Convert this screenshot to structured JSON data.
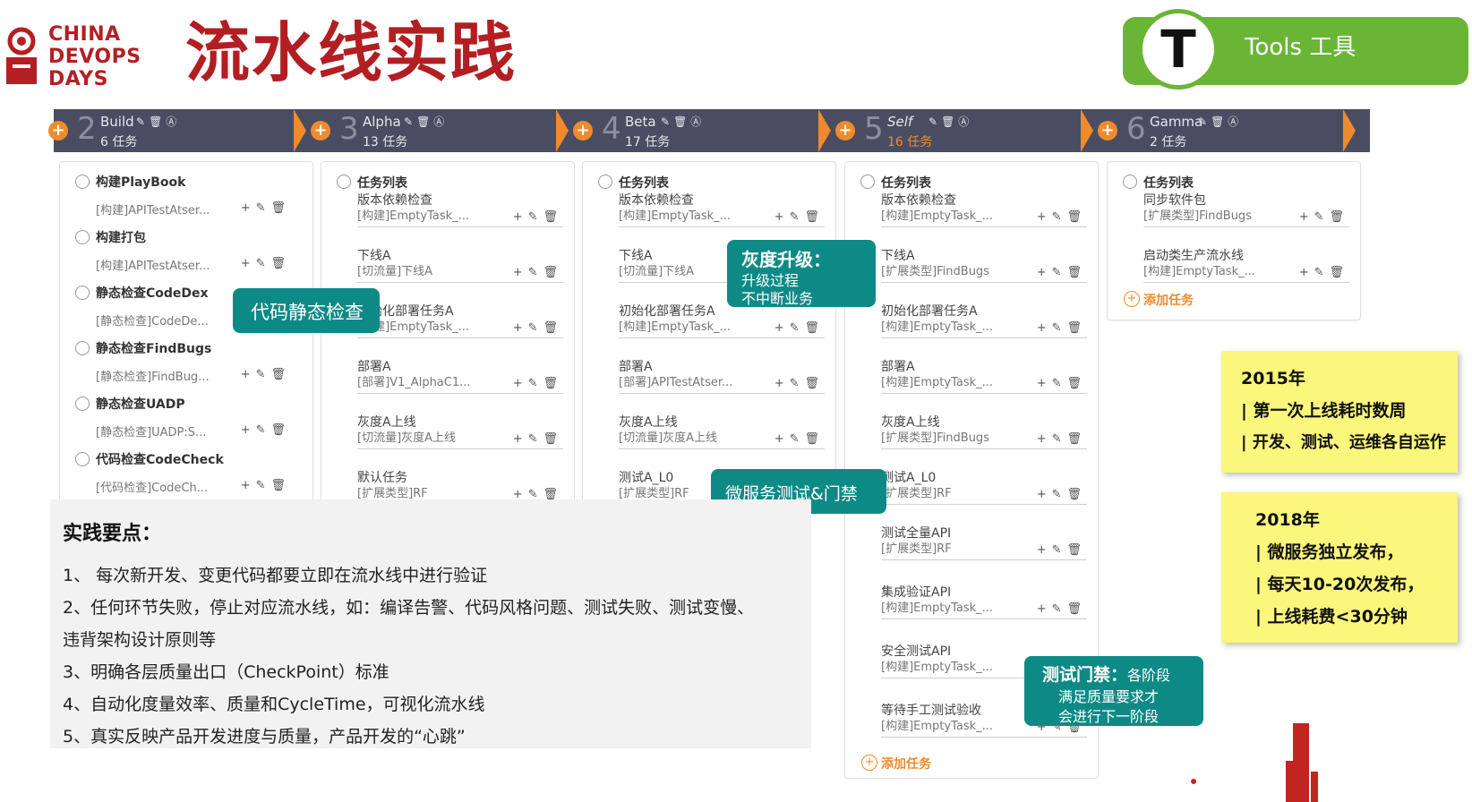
{
  "logo": {
    "line1": "CHINA",
    "line2": "DEVOPS",
    "line3": "DAYS"
  },
  "slide_title": "流水线实践",
  "tools_badge": {
    "letter": "T",
    "label": "Tools 工具"
  },
  "colors": {
    "brand_red": "#b21e22",
    "accent_orange": "#ef8b2c",
    "teal": "#0e8a86",
    "badge_green": "#6bb536",
    "stage_bar": "#4a4d61",
    "sticky_yellow": "#fbf67c"
  },
  "icons": {
    "edit": "✎",
    "delete": "🗑",
    "user": "Ⓐ",
    "plus": "+"
  },
  "stages": [
    {
      "num": "2",
      "name": "Build",
      "tasks": "6 任务"
    },
    {
      "num": "3",
      "name": "Alpha",
      "tasks": "13 任务"
    },
    {
      "num": "4",
      "name": "Beta",
      "tasks": "17 任务"
    },
    {
      "num": "5",
      "name": "Self",
      "tasks": "16 任务"
    },
    {
      "num": "6",
      "name": "Gamma",
      "tasks": "2 任务"
    }
  ],
  "build_column": [
    {
      "title": "构建PlayBook",
      "sub": "[构建]APITestAtser..."
    },
    {
      "title": "构建打包",
      "sub": "[构建]APITestAtser..."
    },
    {
      "title": "静态检查CodeDex",
      "sub": "[静态检查]CodeDe..."
    },
    {
      "title": "静态检查FindBugs",
      "sub": "[静态检查]FindBug..."
    },
    {
      "title": "静态检查UADP",
      "sub": "[静态检查]UADP:S..."
    },
    {
      "title": "代码检查CodeCheck",
      "sub": "[代码检查]CodeCh..."
    }
  ],
  "alpha_column": {
    "group": "任务列表",
    "items": [
      {
        "t1": "版本依赖检查",
        "t2": "[构建]EmptyTask_..."
      },
      {
        "t1": "下线A",
        "t2": "[切流量]下线A"
      },
      {
        "t1": "初始化部署任务A",
        "t2": "[构建]EmptyTask_..."
      },
      {
        "t1": "部署A",
        "t2": "[部署]V1_AlphaC1..."
      },
      {
        "t1": "灰度A上线",
        "t2": "[切流量]灰度A上线"
      },
      {
        "t1": "默认任务",
        "t2": "[扩展类型]RF"
      }
    ]
  },
  "beta_column": {
    "group": "任务列表",
    "items": [
      {
        "t1": "版本依赖检查",
        "t2": "[构建]EmptyTask_..."
      },
      {
        "t1": "下线A",
        "t2": "[切流量]下线A"
      },
      {
        "t1": "初始化部署任务A",
        "t2": "[构建]EmptyTask_..."
      },
      {
        "t1": "部署A",
        "t2": "[部署]APITestAtser..."
      },
      {
        "t1": "灰度A上线",
        "t2": "[切流量]灰度A上线"
      },
      {
        "t1": "测试A_L0",
        "t2": "[扩展类型]RF"
      }
    ]
  },
  "self_column": {
    "group": "任务列表",
    "items": [
      {
        "t1": "版本依赖检查",
        "t2": "[构建]EmptyTask_..."
      },
      {
        "t1": "下线A",
        "t2": "[扩展类型]FindBugs"
      },
      {
        "t1": "初始化部署任务A",
        "t2": "[构建]EmptyTask_..."
      },
      {
        "t1": "部署A",
        "t2": "[构建]EmptyTask_..."
      },
      {
        "t1": "灰度A上线",
        "t2": "[扩展类型]FindBugs"
      },
      {
        "t1": "测试A_L0",
        "t2": "[扩展类型]RF"
      },
      {
        "t1": "测试全量API",
        "t2": "[扩展类型]RF"
      },
      {
        "t1": "集成验证API",
        "t2": "[构建]EmptyTask_..."
      },
      {
        "t1": "安全测试API",
        "t2": "[构建]EmptyTask_..."
      },
      {
        "t1": "等待手工测试验收",
        "t2": "[构建]EmptyTask_..."
      }
    ],
    "add_task": "添加任务"
  },
  "gamma_column": {
    "group": "任务列表",
    "items": [
      {
        "t1": "同步软件包",
        "t2": "[扩展类型]FindBugs"
      },
      {
        "t1": "启动类生产流水线",
        "t2": "[构建]EmptyTask_..."
      }
    ],
    "add_task": "添加任务"
  },
  "callouts": {
    "static_check": "代码静态检查",
    "gray_title": "灰度升级：",
    "gray_line1": "升级过程",
    "gray_line2": "不中断业务",
    "microservice": "微服务测试&门禁",
    "gate_title": "测试门禁：",
    "gate_line1_suffix": "各阶段",
    "gate_line2": "满足质量要求才",
    "gate_line3": "会进行下一阶段"
  },
  "sticky_2015": {
    "year": "2015年",
    "line1": "| 第一次上线耗时数周",
    "line2": "| 开发、测试、运维各自运作"
  },
  "sticky_2018": {
    "year": "2018年",
    "line1": "| 微服务独立发布，",
    "line2": "| 每天10-20次发布，",
    "line3": "| 上线耗费<30分钟"
  },
  "practice": {
    "title": "实践要点：",
    "p1": "1、 每次新开发、变更代码都要立即在流水线中进行验证",
    "p2": "2、任何环节失败，停止对应流水线，如：编译告警、代码风格问题、测试失败、测试变慢、",
    "p2b": "违背架构设计原则等",
    "p3": "3、明确各层质量出口（CheckPoint）标准",
    "p4": "4、自动化度量效率、质量和CycleTime，可视化流水线",
    "p5": "5、真实反映产品开发进度与质量，产品开发的“心跳”"
  }
}
